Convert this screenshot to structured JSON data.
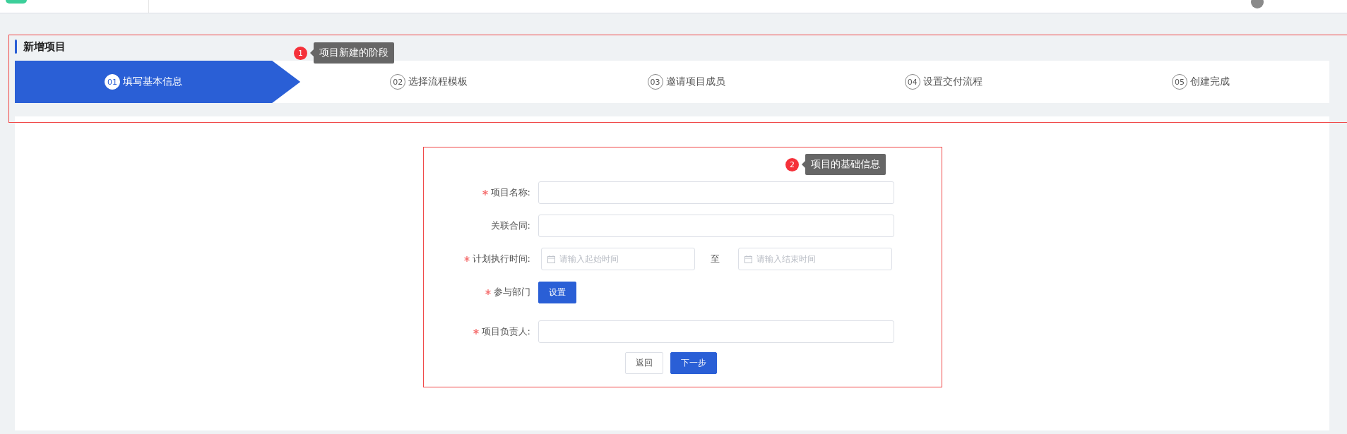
{
  "page_title": "新增项目",
  "steps": [
    {
      "number": "01",
      "label": "填写基本信息",
      "selected": true
    },
    {
      "number": "02",
      "label": "选择流程模板",
      "selected": false
    },
    {
      "number": "03",
      "label": "邀请项目成员",
      "selected": false
    },
    {
      "number": "04",
      "label": "设置交付流程",
      "selected": false
    },
    {
      "number": "05",
      "label": "创建完成",
      "selected": false
    }
  ],
  "form": {
    "fields": [
      {
        "kind": "text",
        "label": "项目名称:",
        "required": true
      },
      {
        "kind": "text",
        "label": "关联合同:",
        "required": false
      },
      {
        "kind": "date-range",
        "label": "计划执行时间:",
        "required": true,
        "start_placeholder": "请输入起始时间",
        "separator": "至",
        "end_placeholder": "请输入结束时间"
      },
      {
        "kind": "button",
        "label": "参与部门",
        "required": true,
        "button": "设置"
      },
      {
        "kind": "text",
        "label": "项目负责人:",
        "required": true
      }
    ],
    "actions": [
      {
        "kind": "secondary",
        "label": "返回"
      },
      {
        "kind": "primary",
        "label": "下一步"
      }
    ]
  },
  "annotations": [
    {
      "number": "1",
      "text": "项目新建的阶段"
    },
    {
      "number": "2",
      "text": "项目的基础信息"
    }
  ]
}
